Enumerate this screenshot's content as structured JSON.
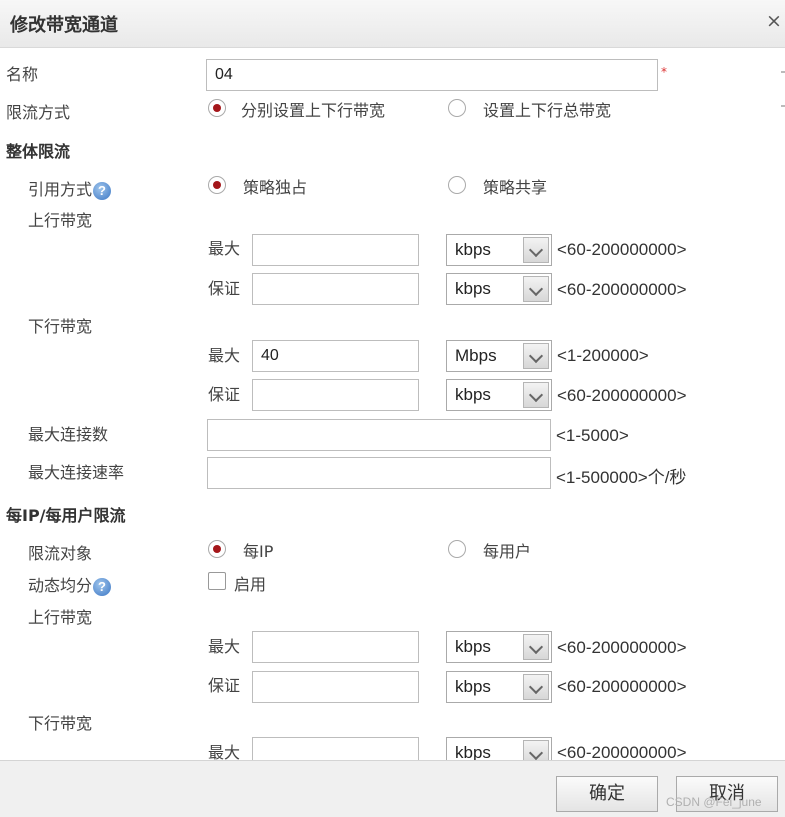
{
  "dialog": {
    "title": "修改带宽通道",
    "close": "×"
  },
  "name": {
    "label": "名称",
    "value": "04",
    "required": "*"
  },
  "limit_mode": {
    "label": "限流方式",
    "options": [
      "分别设置上下行带宽",
      "设置上下行总带宽"
    ],
    "selected": 0
  },
  "overall": {
    "heading": "整体限流",
    "ref_mode": {
      "label": "引用方式",
      "help": "?",
      "options": [
        "策略独占",
        "策略共享"
      ],
      "selected": 0
    },
    "up": {
      "label": "上行带宽",
      "max": {
        "label": "最大",
        "value": "",
        "unit": "kbps",
        "range": "<60-200000000>"
      },
      "guar": {
        "label": "保证",
        "value": "",
        "unit": "kbps",
        "range": "<60-200000000>"
      }
    },
    "down": {
      "label": "下行带宽",
      "max": {
        "label": "最大",
        "value": "40",
        "unit": "Mbps",
        "range": "<1-200000>"
      },
      "guar": {
        "label": "保证",
        "value": "",
        "unit": "kbps",
        "range": "<60-200000000>"
      }
    },
    "max_conn": {
      "label": "最大连接数",
      "value": "",
      "range": "<1-5000>"
    },
    "max_rate": {
      "label": "最大连接速率",
      "value": "",
      "range": "<1-500000>个/秒"
    }
  },
  "per": {
    "heading": "每IP/每用户限流",
    "target": {
      "label": "限流对象",
      "options": [
        "每IP",
        "每用户"
      ],
      "selected": 0
    },
    "dynamic": {
      "label": "动态均分",
      "help": "?",
      "checkbox_label": "启用",
      "checked": false
    },
    "up": {
      "label": "上行带宽",
      "max": {
        "label": "最大",
        "value": "",
        "unit": "kbps",
        "range": "<60-200000000>"
      },
      "guar": {
        "label": "保证",
        "value": "",
        "unit": "kbps",
        "range": "<60-200000000>"
      }
    },
    "down": {
      "label": "下行带宽",
      "max": {
        "label": "最大",
        "value": "",
        "unit": "kbps",
        "range": "<60-200000000>"
      }
    }
  },
  "footer": {
    "ok": "确定",
    "cancel": "取消"
  },
  "watermark": "CSDN @Fei_june",
  "colors": {
    "radio_dot": "#a4161a",
    "required": "#dd3333",
    "help_icon": "#3b76c4"
  }
}
